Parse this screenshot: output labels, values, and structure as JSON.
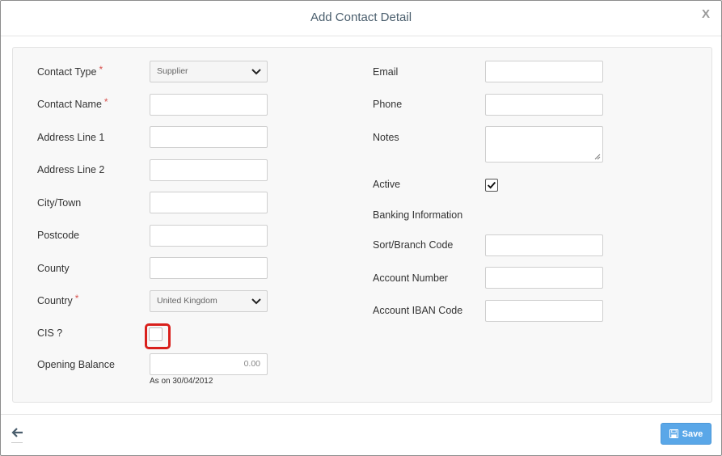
{
  "modal": {
    "title": "Add Contact Detail",
    "close_label": "X"
  },
  "left": {
    "contact_type": {
      "label": "Contact Type",
      "required_mark": "*",
      "value": "Supplier"
    },
    "contact_name": {
      "label": "Contact Name",
      "required_mark": "*",
      "value": ""
    },
    "address1": {
      "label": "Address Line 1",
      "value": ""
    },
    "address2": {
      "label": "Address Line 2",
      "value": ""
    },
    "city": {
      "label": "City/Town",
      "value": ""
    },
    "postcode": {
      "label": "Postcode",
      "value": ""
    },
    "county": {
      "label": "County",
      "value": ""
    },
    "country": {
      "label": "Country",
      "required_mark": "*",
      "value": "United Kingdom"
    },
    "cis": {
      "label": "CIS ?",
      "checked": false
    },
    "opening_balance": {
      "label": "Opening Balance",
      "value": "0.00",
      "hint": "As on 30/04/2012"
    }
  },
  "right": {
    "email": {
      "label": "Email",
      "value": ""
    },
    "phone": {
      "label": "Phone",
      "value": ""
    },
    "notes": {
      "label": "Notes",
      "value": ""
    },
    "active": {
      "label": "Active",
      "checked": true
    },
    "banking_heading": "Banking Information",
    "sort_code": {
      "label": "Sort/Branch Code",
      "value": ""
    },
    "account_number": {
      "label": "Account Number",
      "value": ""
    },
    "account_iban": {
      "label": "Account IBAN Code",
      "value": ""
    }
  },
  "footer": {
    "save_label": "Save",
    "back_icon": "arrow-left-icon",
    "save_icon": "floppy-disk-icon"
  },
  "colors": {
    "primary_button": "#5aa7e8",
    "highlight": "#d9201c",
    "required": "#d9534f",
    "title": "#4a5e6d"
  }
}
